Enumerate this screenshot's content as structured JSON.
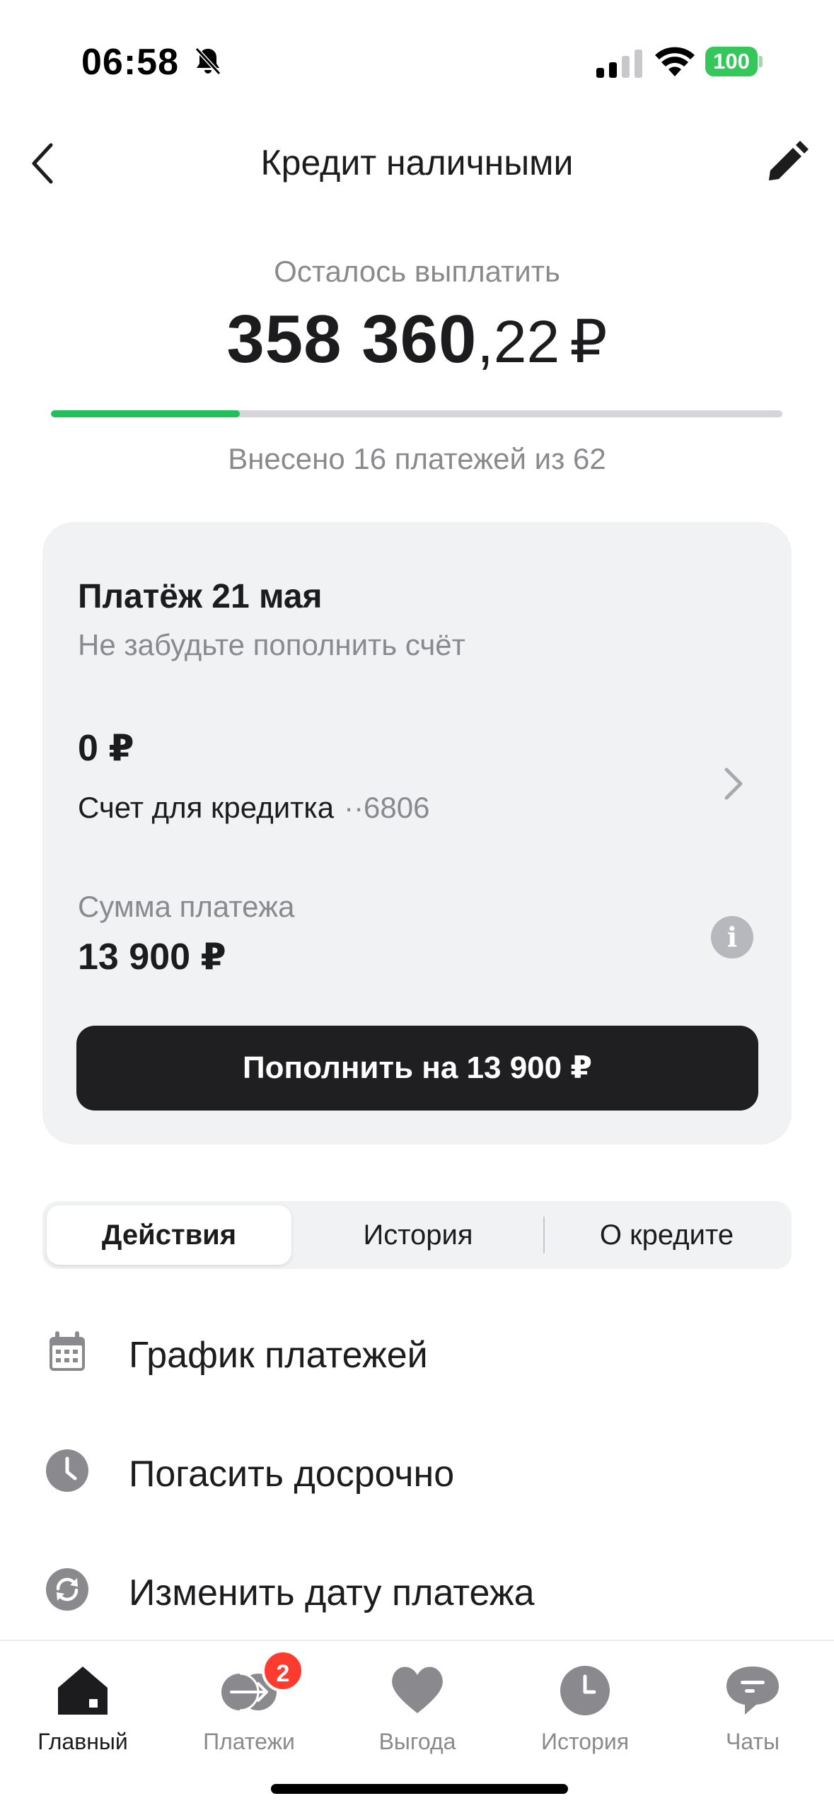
{
  "status_bar": {
    "time": "06:58",
    "battery": "100",
    "icons": [
      "bell-off-icon",
      "cellular-signal-icon",
      "wifi-icon",
      "battery-icon"
    ]
  },
  "header": {
    "title": "Кредит наличными",
    "back_icon": "chevron-left-icon",
    "edit_icon": "pencil-icon"
  },
  "summary": {
    "remaining_label": "Осталось выплатить",
    "amount_int": "358 360",
    "amount_frac": ",22",
    "currency": "₽",
    "progress_fraction": 0.258,
    "paid_text": "Внесено 16 платежей из 62"
  },
  "payment_card": {
    "title": "Платёж 21 мая",
    "subtitle": "Не забудьте пополнить счёт",
    "account_balance": "0 ₽",
    "account_name": "Счет для кредитка",
    "account_mask": "··6806",
    "amount_label": "Сумма платежа",
    "amount_value": "13 900 ₽",
    "info_icon": "info-icon",
    "topup_label": "Пополнить на 13 900 ₽"
  },
  "segments": [
    {
      "label": "Действия",
      "active": true
    },
    {
      "label": "История",
      "active": false
    },
    {
      "label": "О кредите",
      "active": false
    }
  ],
  "actions": [
    {
      "label": "График платежей",
      "icon": "calendar-icon"
    },
    {
      "label": "Погасить досрочно",
      "icon": "clock-icon"
    },
    {
      "label": "Изменить дату платежа",
      "icon": "refresh-icon"
    }
  ],
  "tabbar": [
    {
      "label": "Главный",
      "icon": "home-icon",
      "active": true
    },
    {
      "label": "Платежи",
      "icon": "payments-icon",
      "badge": "2"
    },
    {
      "label": "Выгода",
      "icon": "heart-icon"
    },
    {
      "label": "История",
      "icon": "clock-icon"
    },
    {
      "label": "Чаты",
      "icon": "chat-icon"
    }
  ],
  "colors": {
    "accent_green": "#21c05a",
    "battery_green": "#34c759",
    "badge_red": "#ff3b30",
    "button_dark": "#1f1f21",
    "card_bg": "#f1f2f4",
    "muted_text": "#8a8a8e"
  }
}
